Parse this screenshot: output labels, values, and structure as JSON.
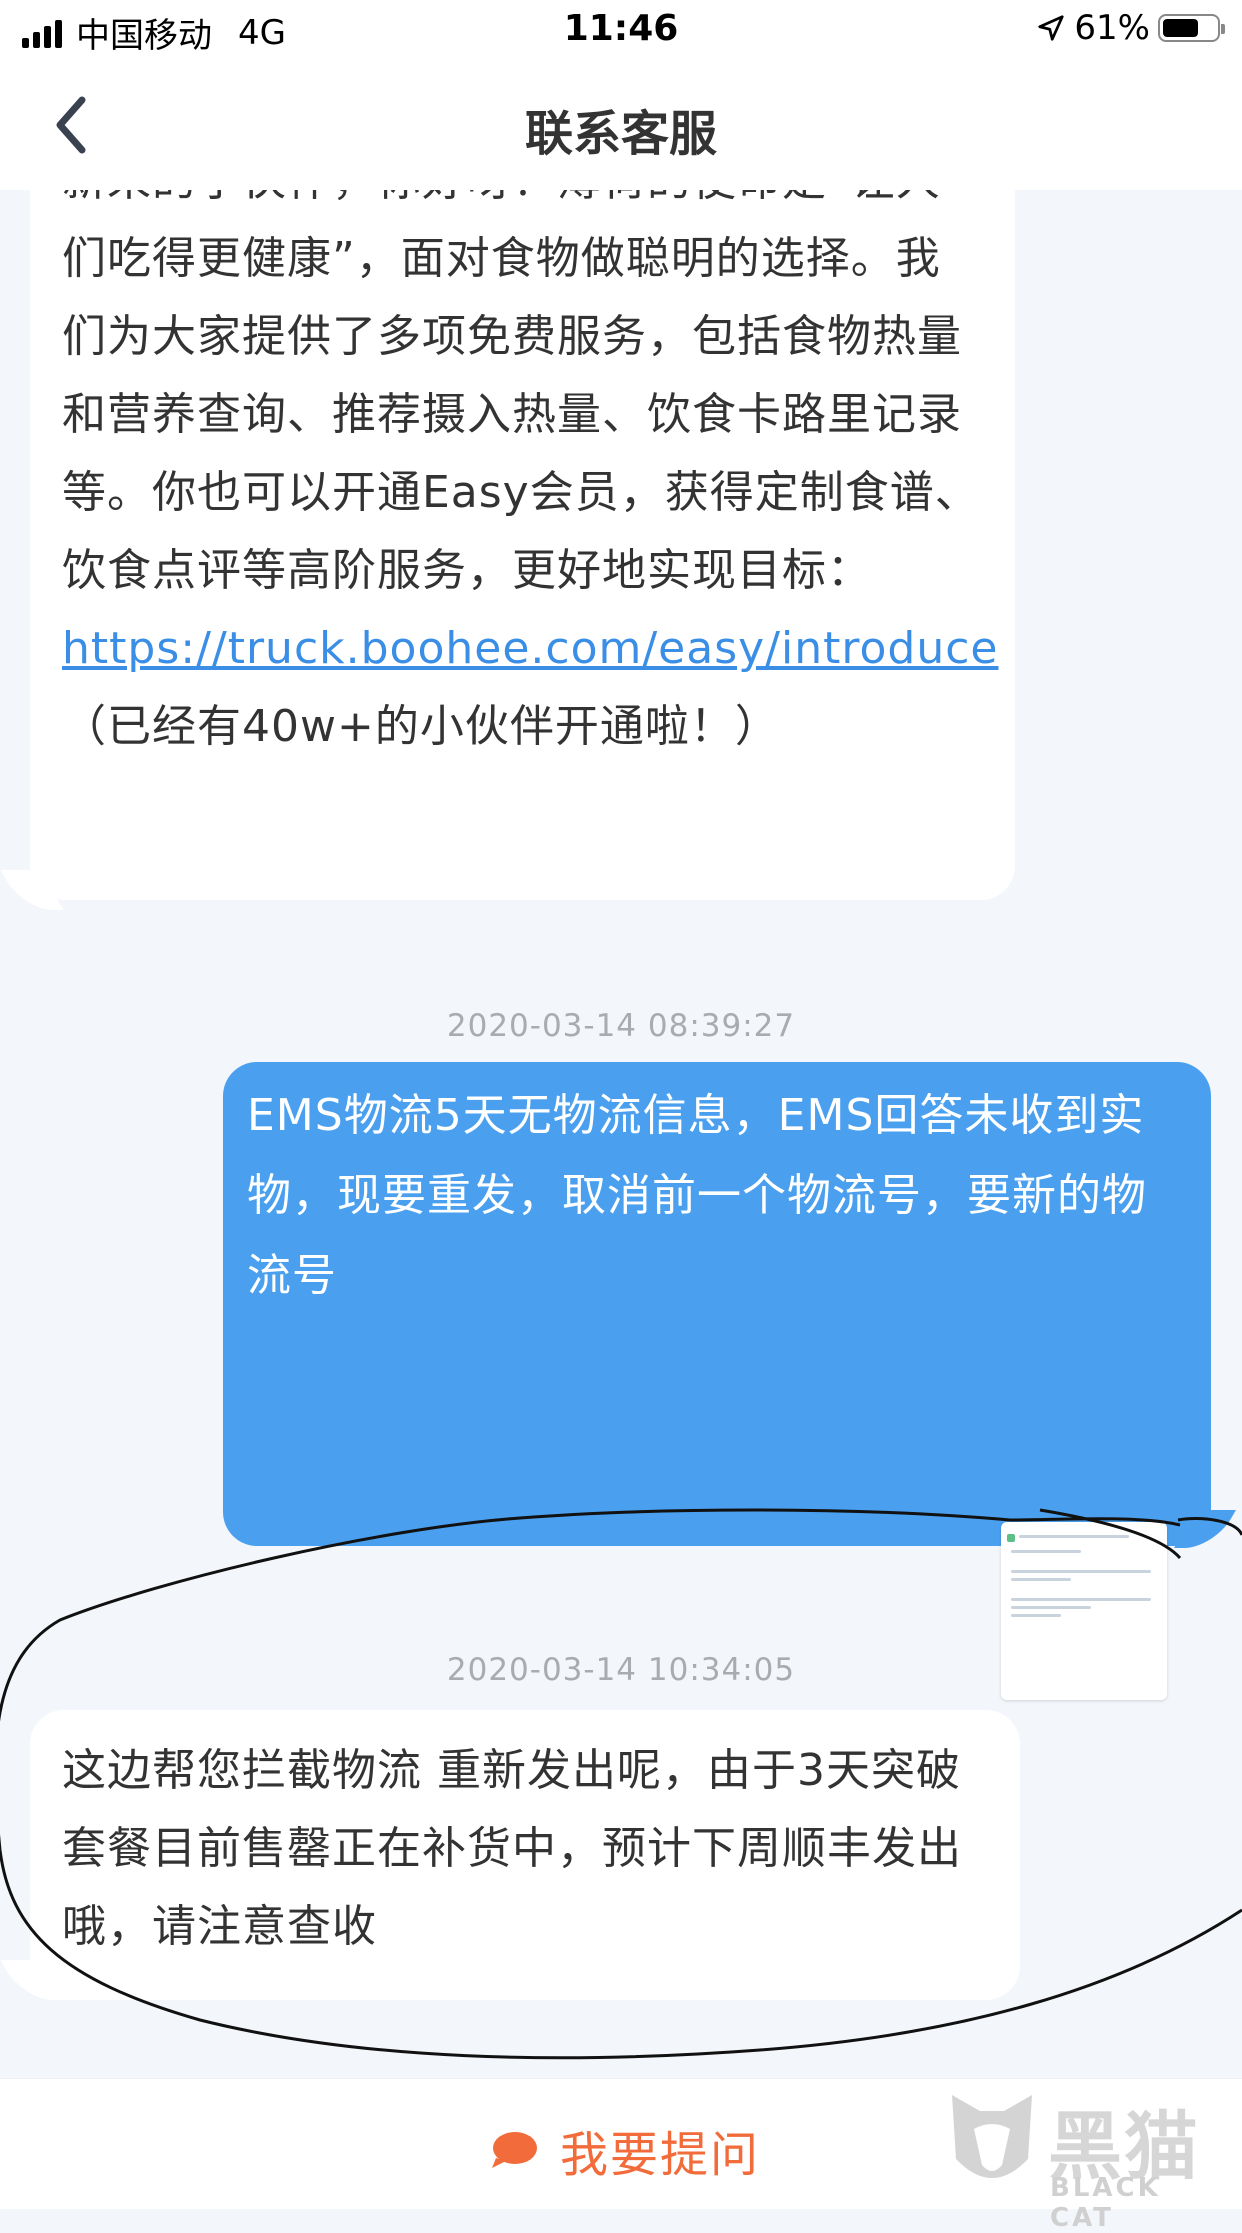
{
  "status_bar": {
    "carrier": "中国移动",
    "network": "4G",
    "time": "11:46",
    "battery": "61%"
  },
  "nav": {
    "title": "联系客服"
  },
  "messages": [
    {
      "side": "left",
      "text_before_link": "新来的小伙伴，你好呀！薄荷的使命是“让人们吃得更健康”，面对食物做聪明的选择。我们为大家提供了多项免费服务，包括食物热量和营养查询、推荐摄入热量、饮食卡路里记录等。你也可以开通Easy会员，获得定制食谱、饮食点评等高阶服务，更好地实现目标：",
      "link": "https://truck.boohee.com/easy/introduce",
      "text_after_link": "（已经有40w+的小伙伴开通啦！）"
    },
    {
      "side": "right",
      "timestamp": "2020-03-14 08:39:27",
      "text": "EMS物流5天无物流信息，EMS回答未收到实物，现要重发，取消前一个物流号，要新的物流号"
    },
    {
      "side": "left",
      "timestamp": "2020-03-14 10:34:05",
      "text": "这边帮您拦截物流 重新发出呢，由于3天突破套餐目前售罄正在补货中，预计下周顺丰发出哦，请注意查收"
    }
  ],
  "bottom": {
    "ask_label": "我要提问"
  },
  "watermark": {
    "text": "黑猫",
    "subtext": "BLACK CAT"
  },
  "colors": {
    "user_bubble": "#4aa0ef",
    "link": "#3a8ee6",
    "ask_accent": "#f26b3a"
  }
}
